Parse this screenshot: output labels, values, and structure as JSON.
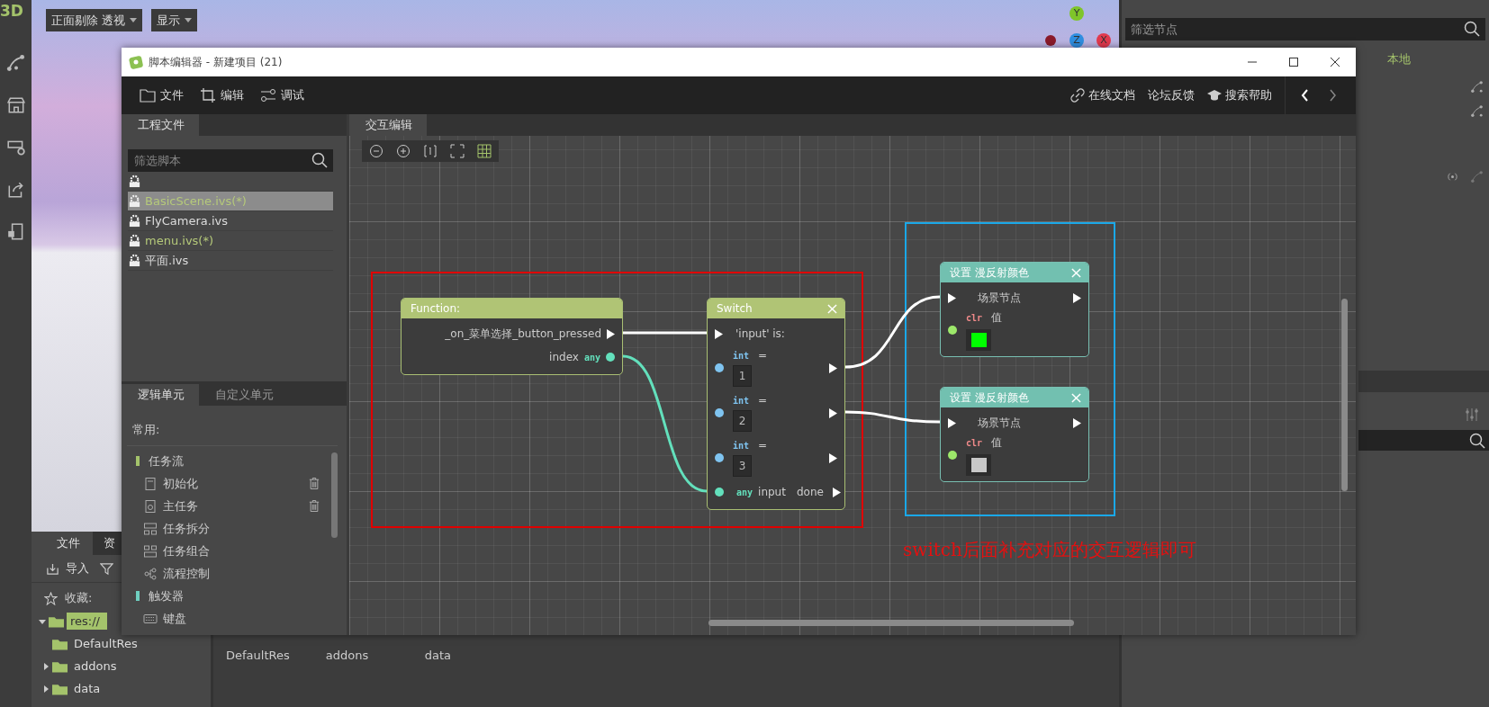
{
  "toolbar": {
    "logo": "3D"
  },
  "viewport": {
    "menus": [
      "正面剔除 透视",
      "显示"
    ],
    "gizmo": [
      {
        "axis": "Y",
        "color": "#7fc52a"
      },
      {
        "axis": "Z",
        "color": "#2f8ee0"
      },
      {
        "axis": "X",
        "color": "#e23a4e"
      }
    ]
  },
  "filesystem": {
    "tabs": [
      {
        "label": "文件",
        "selected": true
      },
      {
        "label": "资",
        "selected": false
      }
    ],
    "import_button": "导入",
    "favorites": "收藏:",
    "tree": [
      {
        "label": "res://",
        "selected": true,
        "expanded": true,
        "children": [
          {
            "label": "DefaultRes",
            "selected": false
          },
          {
            "label": "addons",
            "selected": false,
            "expanded": false
          },
          {
            "label": "data",
            "selected": false,
            "expanded": false
          }
        ]
      }
    ],
    "items": [
      "DefaultRes",
      "addons",
      "data"
    ]
  },
  "scene_panel": {
    "filter_placeholder": "筛选节点",
    "tab": "本地"
  },
  "script_editor": {
    "title": "脚本编辑器 - 新建项目 (21)",
    "menus": [
      "文件",
      "编辑",
      "调试"
    ],
    "links": [
      "在线文档",
      "论坛反馈",
      "搜索帮助"
    ],
    "project_tab": "工程文件",
    "filter_placeholder": "筛选脚本",
    "scripts": [
      {
        "selected": false
      },
      {
        "name": "BasicScene.ivs(*)",
        "selected": true,
        "modified": true
      },
      {
        "name": "FlyCamera.ivs",
        "selected": false,
        "modified": false
      },
      {
        "name": "menu.ivs(*)",
        "selected": false,
        "modified": true
      },
      {
        "name": "平面.ivs",
        "selected": false,
        "modified": false
      }
    ],
    "unit_tabs": [
      {
        "label": "逻辑单元",
        "selected": true
      },
      {
        "label": "自定义单元",
        "selected": false
      }
    ],
    "units_heading": "常用:",
    "unit_groups": [
      {
        "label": "任务流",
        "color": "#a4c36b",
        "items": [
          {
            "label": "初始化",
            "deletable": true
          },
          {
            "label": "主任务",
            "deletable": true
          },
          {
            "label": "任务拆分",
            "deletable": false
          },
          {
            "label": "任务组合",
            "deletable": false
          },
          {
            "label": "流程控制",
            "deletable": false
          }
        ]
      },
      {
        "label": "触发器",
        "color": "#6fcfc0",
        "items": [
          {
            "label": "键盘",
            "deletable": false
          }
        ]
      }
    ],
    "graph_tab": "交互编辑",
    "nodes": [
      {
        "kind": "function",
        "title": "Function:",
        "closable": false,
        "event": "_on_菜单选择_button_pressed",
        "output_name": "index",
        "output_type": "any"
      },
      {
        "kind": "switch",
        "title": "Switch",
        "closable": true,
        "header": "'input' is:",
        "cases": [
          {
            "type": "int",
            "op": "=",
            "value": "1"
          },
          {
            "type": "int",
            "op": "=",
            "value": "2"
          },
          {
            "type": "int",
            "op": "=",
            "value": "3"
          }
        ],
        "input_type": "any",
        "input_name": "input",
        "done": "done"
      },
      {
        "kind": "set_color",
        "title": "设置 漫反射颜色",
        "closable": true,
        "target": "场景节点",
        "param_type": "clr",
        "param_name": "值",
        "color": "#00ff00"
      },
      {
        "kind": "set_color",
        "title": "设置 漫反射颜色",
        "closable": true,
        "target": "场景节点",
        "param_type": "clr",
        "param_name": "值",
        "color": "#c8c8c8"
      }
    ],
    "note": "switch后面补充对应的交互逻辑即可"
  }
}
